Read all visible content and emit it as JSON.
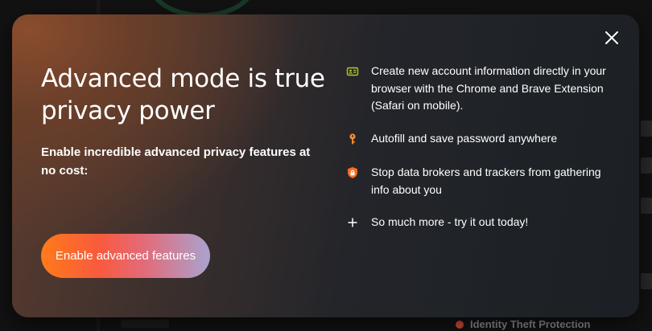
{
  "modal": {
    "headline": "Advanced mode is true privacy power",
    "subheadline": "Enable incredible advanced privacy features at no cost:",
    "cta_label": "Enable advanced features",
    "close_icon": "close-icon",
    "features": [
      {
        "icon": "id-card-icon",
        "text": "Create new account information directly in your browser with the Chrome and Brave Extension (Safari on mobile)."
      },
      {
        "icon": "key-icon",
        "text": "Autofill and save password anywhere"
      },
      {
        "icon": "shield-lock-icon",
        "text": "Stop data brokers and trackers from gathering info about you"
      },
      {
        "icon": "plus-icon",
        "text": "So much more - try it out today!"
      }
    ]
  },
  "background": {
    "bottom_item": "Identity Theft Protection"
  },
  "colors": {
    "accent_orange": "#ff7a1a",
    "accent_red": "#f85a3e",
    "accent_lavender": "#a9a3cf",
    "icon_green": "#b5c922",
    "icon_orange": "#ff8a2a"
  }
}
